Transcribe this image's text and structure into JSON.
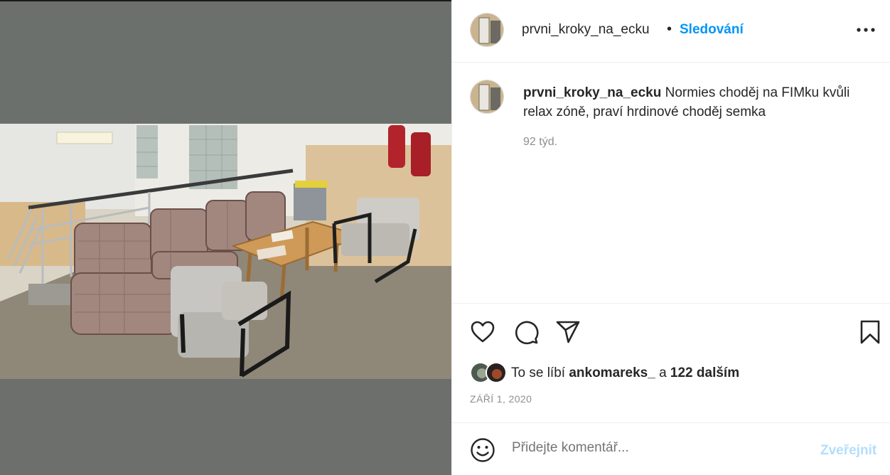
{
  "post": {
    "username": "prvni_kroky_na_ecku",
    "separator": "•",
    "follow_label": "Sledování",
    "more_icon": "more-horizontal-icon"
  },
  "caption": {
    "username": "prvni_kroky_na_ecku",
    "text": " Normies choděj na FIMku kvůli relax zóně, praví hrdinové choděj semka",
    "time": "92 týd."
  },
  "actions": {
    "icons": [
      "heart-icon",
      "comment-icon",
      "share-icon",
      "bookmark-icon"
    ]
  },
  "likes": {
    "prefix": "To se líbí ",
    "user": "ankomareks_",
    "middle": " a ",
    "count": "122 dalším"
  },
  "date": "ZÁŘÍ 1, 2020",
  "comment": {
    "placeholder": "Přidejte komentář...",
    "post_label": "Zveřejnit",
    "emoji_icon": "emoji-icon"
  },
  "colors": {
    "accent": "#0095f6",
    "accent_disabled": "#b2dffc",
    "muted": "#8e8e8e",
    "text": "#262626"
  }
}
